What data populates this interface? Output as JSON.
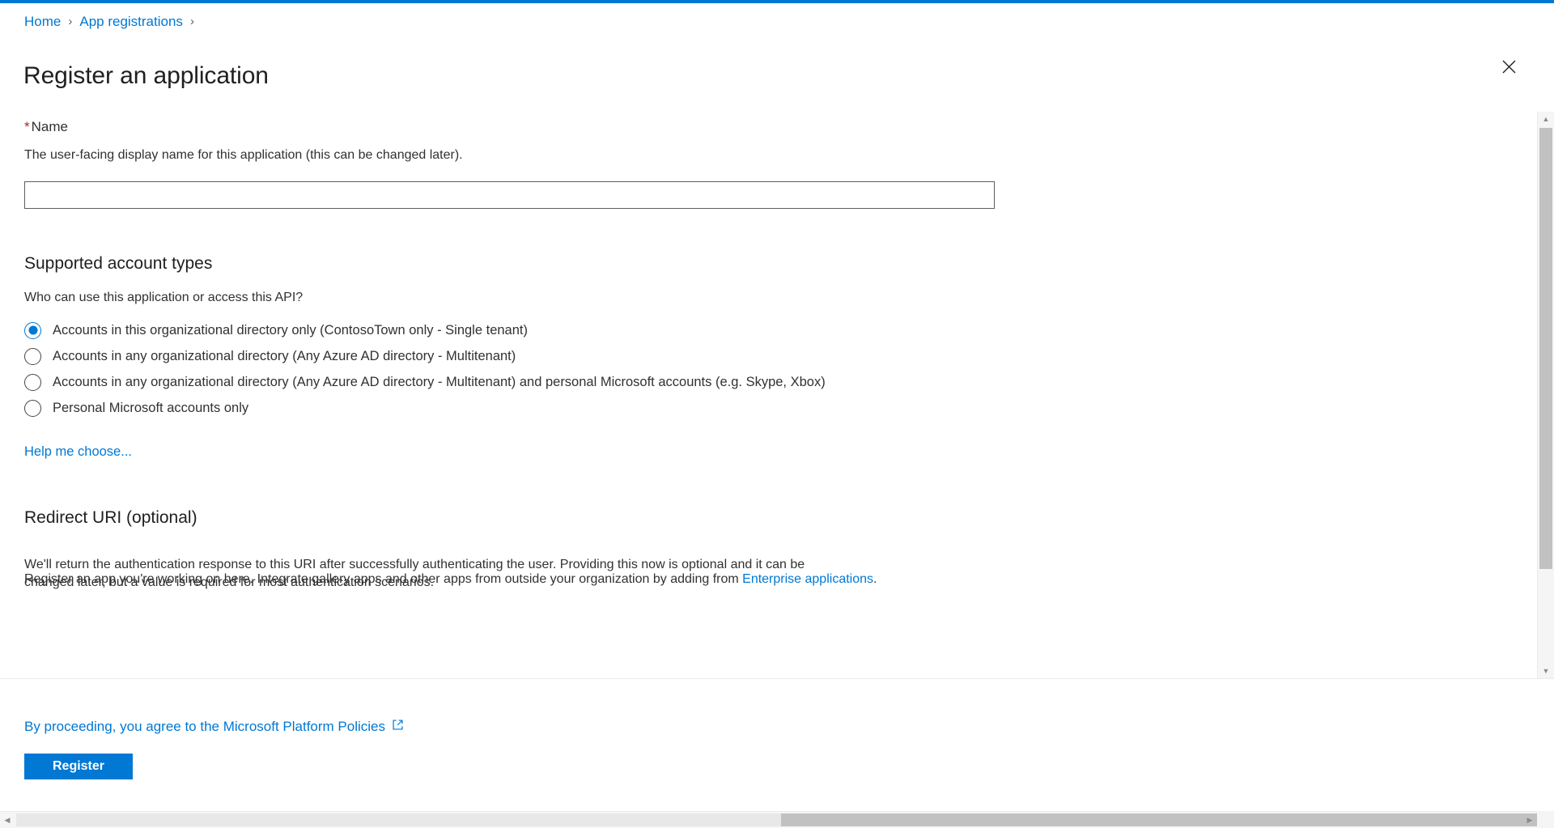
{
  "theme": {
    "accent": "#0078d4",
    "required_star": "#a4262c",
    "text": "#323130",
    "link": "#0078d4"
  },
  "breadcrumb": {
    "items": [
      {
        "label": "Home"
      },
      {
        "label": "App registrations"
      }
    ],
    "separator": "›"
  },
  "header": {
    "title": "Register an application",
    "close_label": "Close"
  },
  "name_field": {
    "required_marker": "*",
    "label": "Name",
    "description": "The user-facing display name for this application (this can be changed later).",
    "value": "",
    "placeholder": ""
  },
  "supported_account_types": {
    "heading": "Supported account types",
    "question": "Who can use this application or access this API?",
    "options": [
      {
        "label": "Accounts in this organizational directory only (ContosoTown only - Single tenant)",
        "selected": true
      },
      {
        "label": "Accounts in any organizational directory (Any Azure AD directory - Multitenant)",
        "selected": false
      },
      {
        "label": "Accounts in any organizational directory (Any Azure AD directory - Multitenant) and personal Microsoft accounts (e.g. Skype, Xbox)",
        "selected": false
      },
      {
        "label": "Personal Microsoft accounts only",
        "selected": false
      }
    ],
    "help_link": "Help me choose..."
  },
  "redirect_uri": {
    "heading": "Redirect URI (optional)",
    "description_line1": "We'll return the authentication response to this URI after successfully authenticating the user. Providing this now is optional and it can be",
    "description_line2": "changed later, but a value is required for most authentication scenarios.",
    "overlay_text": "Register an app you're working on here. Integrate gallery apps and other apps from outside your organization by adding from ",
    "overlay_link": "Enterprise applications",
    "overlay_tail": "."
  },
  "footer": {
    "policy_text": "By proceeding, you agree to the Microsoft Platform Policies",
    "policy_icon": "external-link-icon",
    "register_label": "Register"
  },
  "scrollbars": {
    "vertical_up": "▲",
    "vertical_down": "▼",
    "horizontal_left": "◀",
    "horizontal_right": "▶"
  }
}
